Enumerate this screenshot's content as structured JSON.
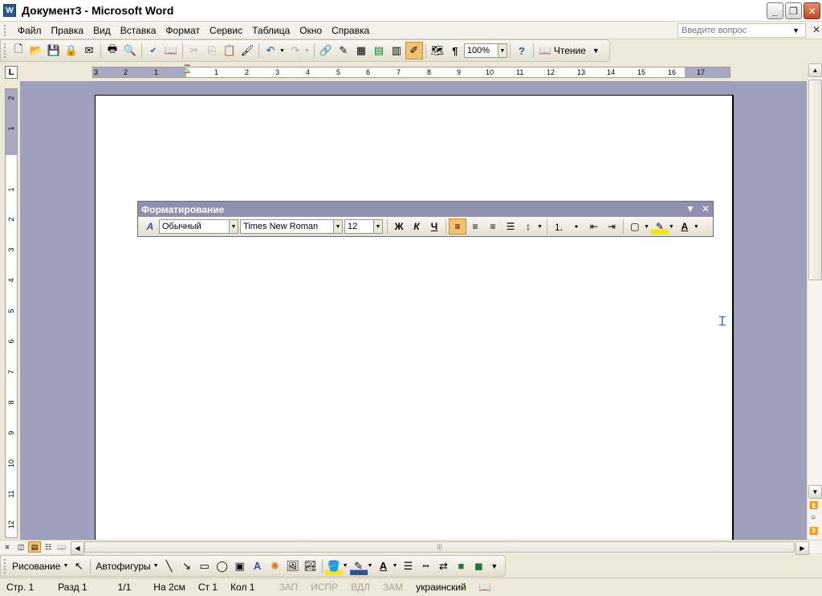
{
  "window": {
    "title": "Документ3 - Microsoft Word"
  },
  "menu": {
    "items": [
      "Файл",
      "Правка",
      "Вид",
      "Вставка",
      "Формат",
      "Сервис",
      "Таблица",
      "Окно",
      "Справка"
    ],
    "help_placeholder": "Введите вопрос"
  },
  "standard_toolbar": {
    "zoom": "100%",
    "read_label": "Чтение"
  },
  "ruler": {
    "h_numbers": [
      "3",
      "2",
      "1",
      "1",
      "2",
      "3",
      "4",
      "5",
      "6",
      "7",
      "8",
      "9",
      "10",
      "11",
      "12",
      "13",
      "14",
      "15",
      "16",
      "17"
    ],
    "v_numbers": [
      "2",
      "1",
      "1",
      "2",
      "3",
      "4",
      "5",
      "6",
      "7",
      "8",
      "9",
      "10",
      "11",
      "12"
    ]
  },
  "formatting_toolbar": {
    "title": "Форматирование",
    "style": "Обычный",
    "font": "Times New Roman",
    "size": "12",
    "bold_label": "Ж",
    "italic_label": "К",
    "underline_label": "Ч"
  },
  "drawing_toolbar": {
    "draw_label": "Рисование",
    "autoshapes_label": "Автофигуры"
  },
  "status": {
    "page": "Стр. 1",
    "section": "Разд 1",
    "pages": "1/1",
    "at": "На 2см",
    "line": "Ст 1",
    "col": "Кол 1",
    "rec": "ЗАП",
    "trk": "ИСПР",
    "ext": "ВДЛ",
    "ovr": "ЗАМ",
    "language": "украинский"
  },
  "colors": {
    "accent_active": "#f6c26e",
    "doc_background": "#9e9fbd",
    "float_title": "#8f8fb0"
  }
}
